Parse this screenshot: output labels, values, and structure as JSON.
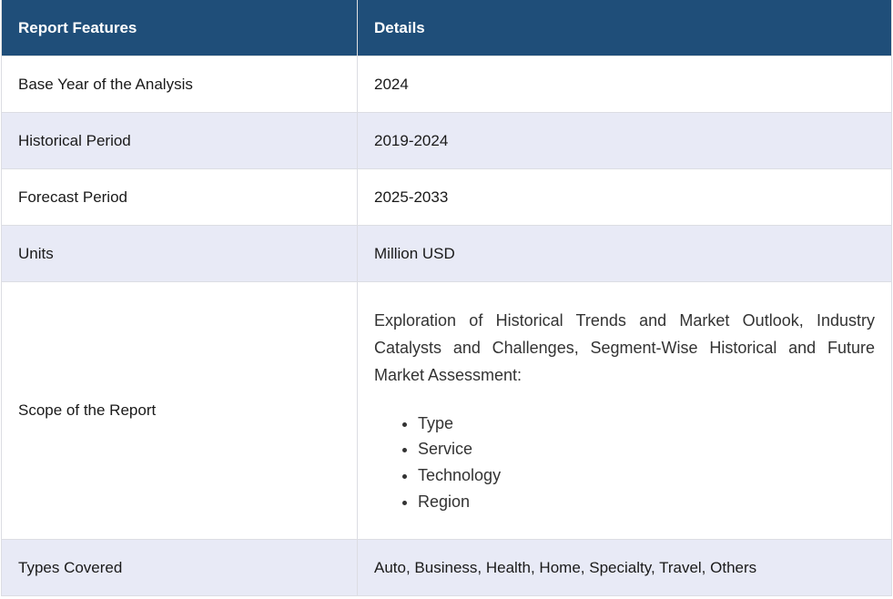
{
  "header": {
    "col1": "Report Features",
    "col2": "Details"
  },
  "rows": [
    {
      "feature": "Base Year of the Analysis",
      "detail": "2024"
    },
    {
      "feature": "Historical Period",
      "detail": "2019-2024"
    },
    {
      "feature": "Forecast Period",
      "detail": "2025-2033"
    },
    {
      "feature": "Units",
      "detail": "Million USD"
    }
  ],
  "scope": {
    "feature": "Scope of the Report",
    "description": "Exploration of Historical Trends and Market Outlook, Industry Catalysts and Challenges, Segment-Wise Historical and Future Market Assessment:",
    "items": [
      "Type",
      "Service",
      "Technology",
      "Region"
    ]
  },
  "types": {
    "feature": "Types Covered",
    "detail": "Auto, Business, Health, Home, Specialty, Travel, Others"
  },
  "colors": {
    "header_bg": "#1f4e79",
    "alt_row_bg": "#e8eaf6"
  }
}
